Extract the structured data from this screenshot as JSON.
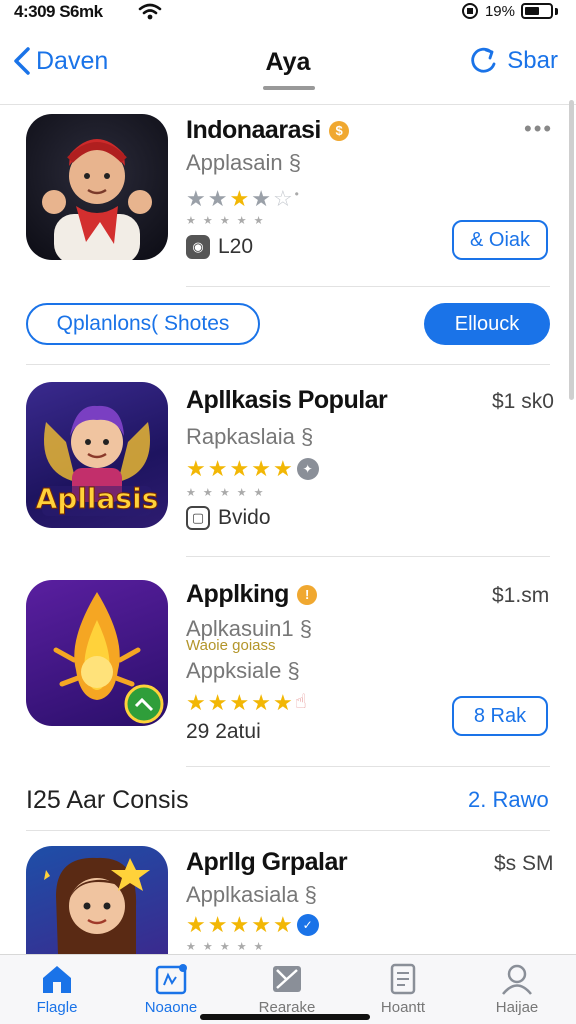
{
  "status": {
    "time": "4:309 S6mk",
    "battery": "19%",
    "battery_level": 0.6
  },
  "nav": {
    "back_label": "Daven",
    "title": "Aya",
    "right_label": "Sbar"
  },
  "apps": [
    {
      "title": "Indonaarasi",
      "subtitle": "Applasain §",
      "meta": "L20",
      "button": "& Oiak",
      "icon": "person-scarf-icon",
      "rating": 3
    },
    {
      "title": "Apllkasis Popular",
      "subtitle": "Rapkaslaia §",
      "meta": "Bvido",
      "price": "$1 sk0",
      "icon_text": "Apllasis",
      "icon": "fairy-icon",
      "rating": 5
    },
    {
      "title": "Applking",
      "subtitle": "Aplkasuin1 §",
      "note": "Waoie goiass",
      "subtitle2": "Appksiale §",
      "meta": "29 2atui",
      "price": "$1.sm",
      "button": "8 Rak",
      "icon": "flame-icon",
      "rating": 5
    },
    {
      "title": "Aprllg Grpalar",
      "subtitle": "Applkasiala §",
      "price": "$s SM",
      "icon": "girl-avatar-icon",
      "rating": 5
    }
  ],
  "pills": {
    "outline_label": "Qplanlons( Shotes",
    "fill_label": "Ellouck"
  },
  "section": {
    "title": "I25 Aar Consis",
    "link": "2. Rawo"
  },
  "tabs": [
    {
      "label": "Flagle",
      "icon": "home-icon",
      "active": true
    },
    {
      "label": "Noaone",
      "icon": "news-icon",
      "active": false
    },
    {
      "label": "Rearake",
      "icon": "game-icon",
      "active": false
    },
    {
      "label": "Hoantt",
      "icon": "document-icon",
      "active": false
    },
    {
      "label": "Haijae",
      "icon": "person-icon",
      "active": false
    }
  ],
  "colors": {
    "accent": "#1a73e8",
    "star": "#f2b705"
  }
}
